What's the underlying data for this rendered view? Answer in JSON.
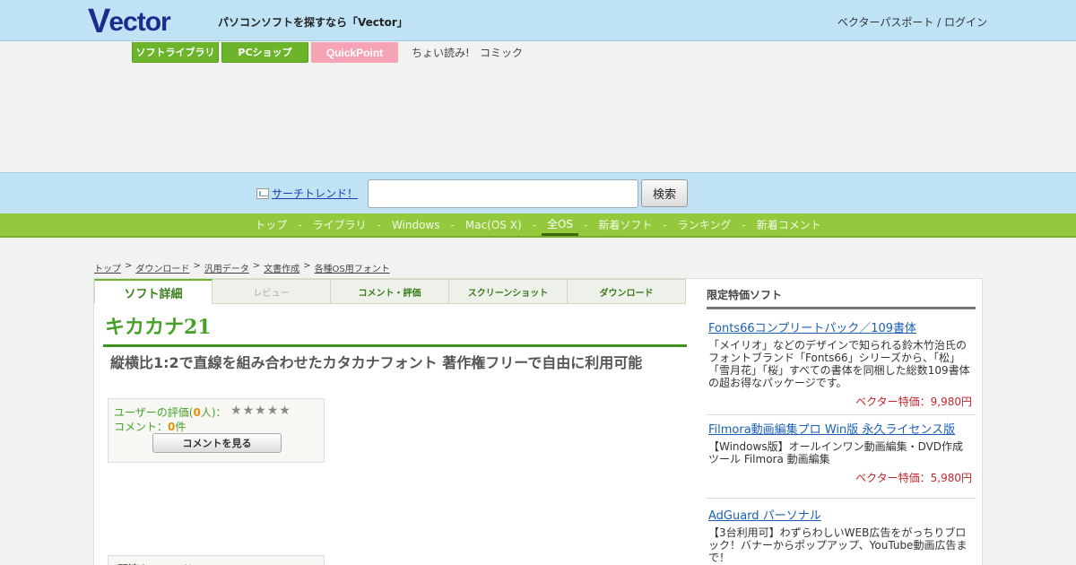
{
  "header": {
    "logo_lead": "V",
    "logo_rest": "ector",
    "tagline": "パソコンソフトを探すなら「Vector」",
    "passport": "ベクターパスポート / ログイン"
  },
  "service_tabs": [
    {
      "label": "ソフトライブラリ"
    },
    {
      "label": "PCショップ"
    },
    {
      "label": "QuickPoint"
    }
  ],
  "service_links": [
    "ちょい読み!",
    "コミック"
  ],
  "search": {
    "trend_label": "サーチトレンド！",
    "button_label": "検索",
    "value": ""
  },
  "nav": {
    "items": [
      "トップ",
      "ライブラリ",
      "Windows",
      "Mac(OS X)",
      "全OS",
      "新着ソフト",
      "ランキング",
      "新着コメント"
    ],
    "active": "全OS",
    "separator": "-"
  },
  "breadcrumb": [
    "トップ",
    "ダウンロード",
    "汎用データ",
    "文書作成",
    "各種OS用フォント"
  ],
  "tabs": [
    "ソフト詳細",
    "レビュー",
    "コメント・評価",
    "スクリーンショット",
    "ダウンロード"
  ],
  "software": {
    "title": "キカカナ21",
    "catchcopy": "縦横比1:2で直線を組み合わせたカタカナフォント 著作権フリーで自由に利用可能",
    "rating_label": "ユーザーの評価(",
    "rating_count": "0",
    "rating_suffix": "人)：",
    "stars": [
      "★",
      "★",
      "★",
      "★",
      "★"
    ],
    "comment_label": "コメント：",
    "comment_count": "0",
    "comment_suffix": "件",
    "view_comments_button": "コメントを見る",
    "related_heading": "関連キーワード"
  },
  "sidebar": {
    "heading": "限定特価ソフト",
    "items": [
      {
        "title": "Fonts66コンプリートパック／109書体",
        "desc": "「メイリオ」などのデザインで知られる鈴木竹治氏のフォントブランド「Fonts66」シリーズから、「松」「雪月花」「桜」すべての書体を同梱した総数109書体の超お得なパッケージです。",
        "price": "ベクター特価：9,980円"
      },
      {
        "title": "Filmora動画編集プロ Win版 永久ライセンス版",
        "desc": "【Windows版】オールインワン動画編集・DVD作成ツール Filmora 動画編集",
        "price": "ベクター特価：5,980円"
      },
      {
        "title": "AdGuard パーソナル",
        "desc": "【3台利用可】わずらわしいWEB広告をがっちりブロック！バナーからポップアップ、YouTube動画広告まで！",
        "price": ""
      }
    ]
  },
  "colors": {
    "header_bg": "#bfe2f5",
    "nav_green": "#94c93e",
    "title_green": "#48a12a",
    "price_red": "#c0282f",
    "link_blue": "#1a5fb5"
  }
}
